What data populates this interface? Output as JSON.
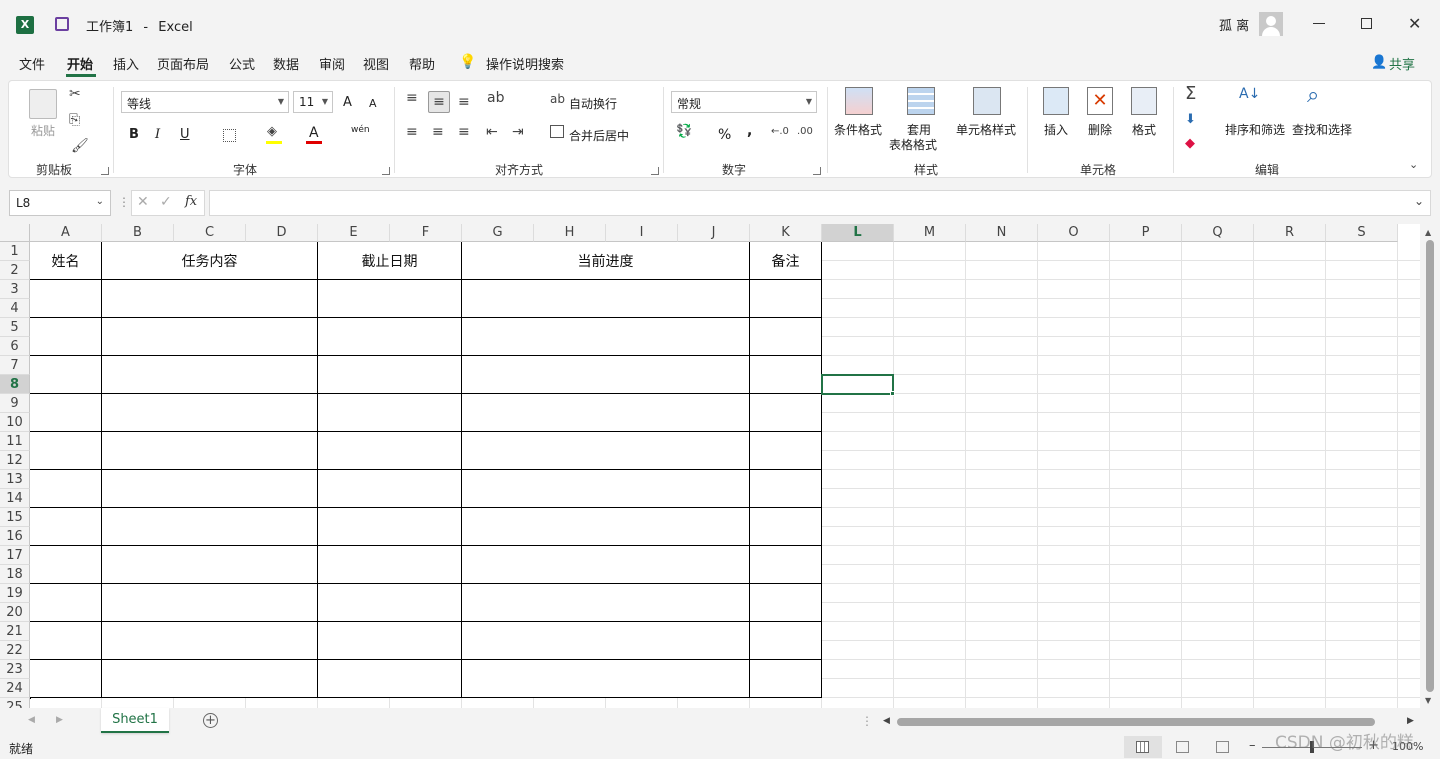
{
  "title": {
    "doc_name": "工作簿1",
    "separator": "-",
    "app_name": "Excel",
    "user_name": "孤 离"
  },
  "menu": {
    "items": [
      "文件",
      "开始",
      "插入",
      "页面布局",
      "公式",
      "数据",
      "审阅",
      "视图",
      "帮助"
    ],
    "active": "开始",
    "search_label": "操作说明搜索",
    "share_label": "共享"
  },
  "ribbon": {
    "clipboard": {
      "paste": "粘贴",
      "group": "剪贴板"
    },
    "font": {
      "name": "等线",
      "size": "11",
      "bold": "B",
      "italic": "I",
      "underline": "U",
      "grow": "A",
      "shrink": "A",
      "phonetic": "wén",
      "group": "字体"
    },
    "alignment": {
      "wrap": "自动换行",
      "merge": "合并后居中",
      "group": "对齐方式"
    },
    "number": {
      "format": "常规",
      "percent": "%",
      "comma": ",",
      "group": "数字"
    },
    "styles": {
      "conditional": "条件格式",
      "table_line1": "套用",
      "table_line2": "表格格式",
      "cell_styles": "单元格样式",
      "group": "样式"
    },
    "cells": {
      "insert": "插入",
      "delete": "删除",
      "format": "格式",
      "group": "单元格"
    },
    "editing": {
      "sort": "排序和筛选",
      "find": "查找和选择",
      "group": "编辑"
    }
  },
  "formula_bar": {
    "name_box": "L8",
    "fx": "fx",
    "value": ""
  },
  "columns": [
    "A",
    "B",
    "C",
    "D",
    "E",
    "F",
    "G",
    "H",
    "I",
    "J",
    "K",
    "L",
    "M",
    "N",
    "O",
    "P",
    "Q",
    "R",
    "S"
  ],
  "rows": [
    "1",
    "2",
    "3",
    "4",
    "5",
    "6",
    "7",
    "8",
    "9",
    "10",
    "11",
    "12",
    "13",
    "14",
    "15",
    "16",
    "17",
    "18",
    "19",
    "20",
    "21",
    "22",
    "23",
    "24",
    "25"
  ],
  "selected_cell": {
    "column": "L",
    "row": "8"
  },
  "table": {
    "headers": [
      "姓名",
      "任务内容",
      "截止日期",
      "当前进度",
      "备注"
    ]
  },
  "sheet_tabs": [
    "Sheet1"
  ],
  "status": {
    "ready": "就绪",
    "zoom": "100%",
    "watermark": "CSDN @初秋的糕"
  },
  "colors": {
    "accent": "#217346",
    "table_border": "#000000",
    "gridline": "#e3e3e3"
  }
}
